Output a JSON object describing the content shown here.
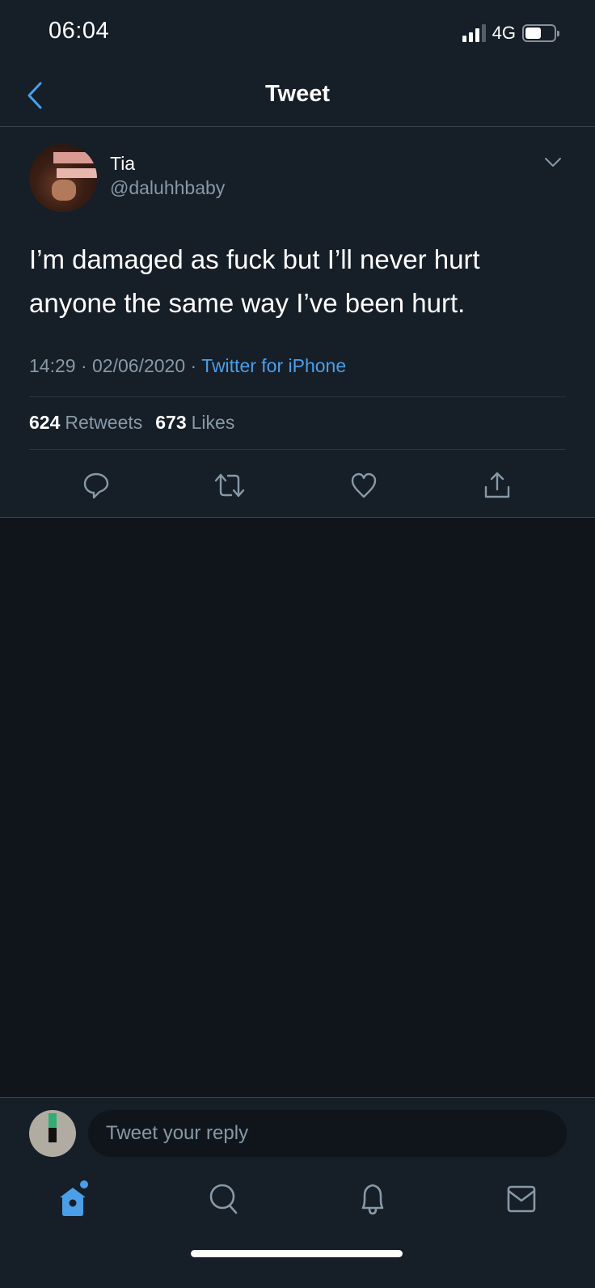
{
  "status_bar": {
    "time": "06:04",
    "network": "4G",
    "battery_level": 0.55,
    "signal_bars": 3,
    "signal_max": 4
  },
  "nav": {
    "title": "Tweet",
    "back_icon": "chevron-left-icon"
  },
  "tweet": {
    "author_name": "Tia",
    "author_handle": "@daluhhbaby",
    "text": "I’m damaged as fuck but I’ll never hurt anyone the same way I’ve been hurt.",
    "time": "14:29",
    "date": "02/06/2020",
    "separator": " · ",
    "source": "Twitter for iPhone",
    "retweets_count": "624",
    "retweets_label": "Retweets",
    "likes_count": "673",
    "likes_label": "Likes",
    "actions": [
      "reply-icon",
      "retweet-icon",
      "like-icon",
      "share-icon"
    ]
  },
  "reply": {
    "placeholder": "Tweet your reply"
  },
  "tabbar": {
    "items": [
      "home",
      "search",
      "notifications",
      "messages"
    ],
    "active": "home"
  },
  "colors": {
    "accent": "#4a9fe8",
    "background": "#161e28",
    "muted_text": "#8899a6",
    "body_bg": "#10151c"
  }
}
